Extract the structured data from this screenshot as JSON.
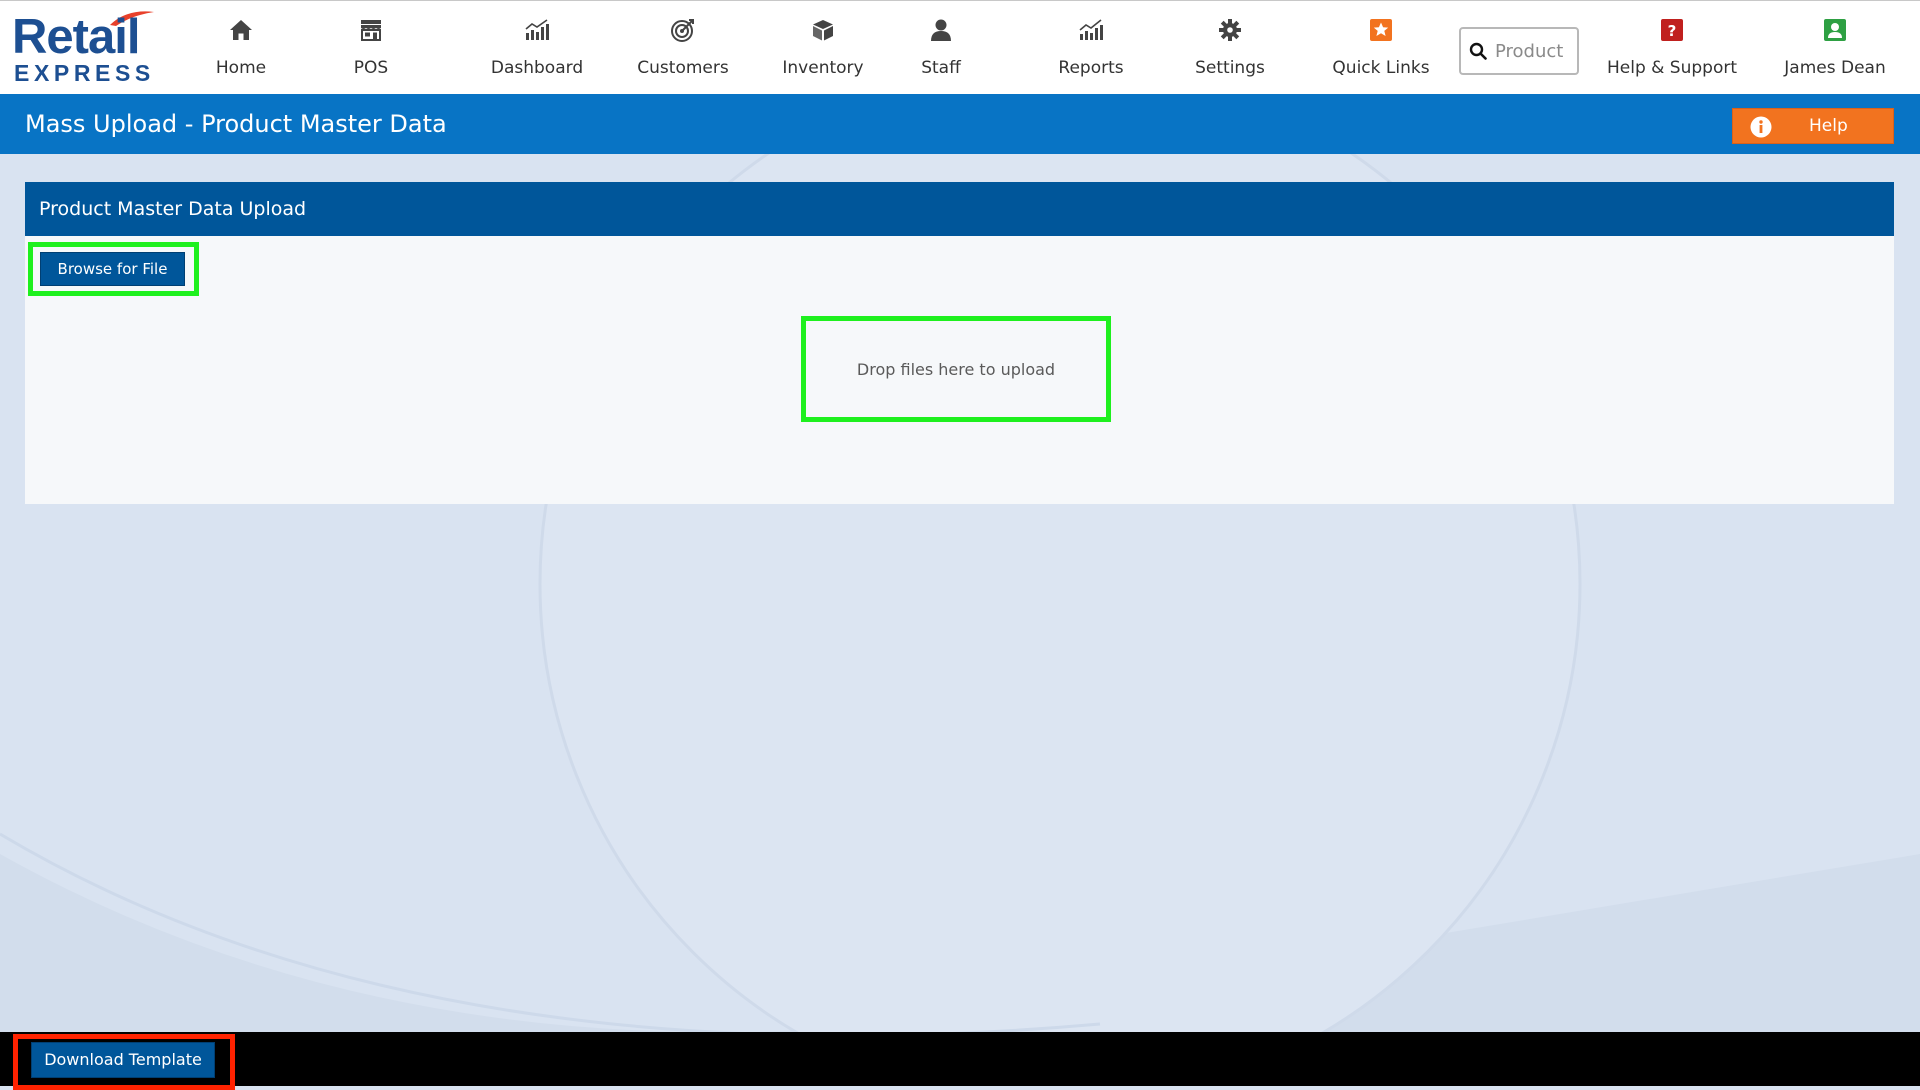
{
  "brand": {
    "name_line1": "Retail",
    "name_line2": "EXPRESS",
    "primary_color": "#1d4f92",
    "accent_color": "#e8402a"
  },
  "nav": {
    "items": [
      {
        "label": "Home",
        "icon": "home-icon"
      },
      {
        "label": "POS",
        "icon": "store-icon"
      },
      {
        "label": "Dashboard",
        "icon": "bar-chart-icon"
      },
      {
        "label": "Customers",
        "icon": "target-icon"
      },
      {
        "label": "Inventory",
        "icon": "box-icon"
      },
      {
        "label": "Staff",
        "icon": "person-icon"
      },
      {
        "label": "Reports",
        "icon": "line-chart-icon"
      },
      {
        "label": "Settings",
        "icon": "gear-icon"
      },
      {
        "label": "Quick Links",
        "icon": "star-icon"
      },
      {
        "label": "Help & Support",
        "icon": "question-icon"
      },
      {
        "label": "James Dean",
        "icon": "user-icon"
      }
    ],
    "search": {
      "placeholder": "Product",
      "value": ""
    }
  },
  "titlebar": {
    "title": "Mass Upload - Product Master Data",
    "help_label": "Help",
    "color": "#0874c5",
    "help_color": "#f2731f"
  },
  "panel": {
    "header": "Product Master Data Upload",
    "browse_label": "Browse for File",
    "drop_text": "Drop files here to upload",
    "header_color": "#00569a"
  },
  "footer": {
    "download_label": "Download Template"
  },
  "highlights": {
    "green": "#1ef01e",
    "red": "#ff2200"
  }
}
